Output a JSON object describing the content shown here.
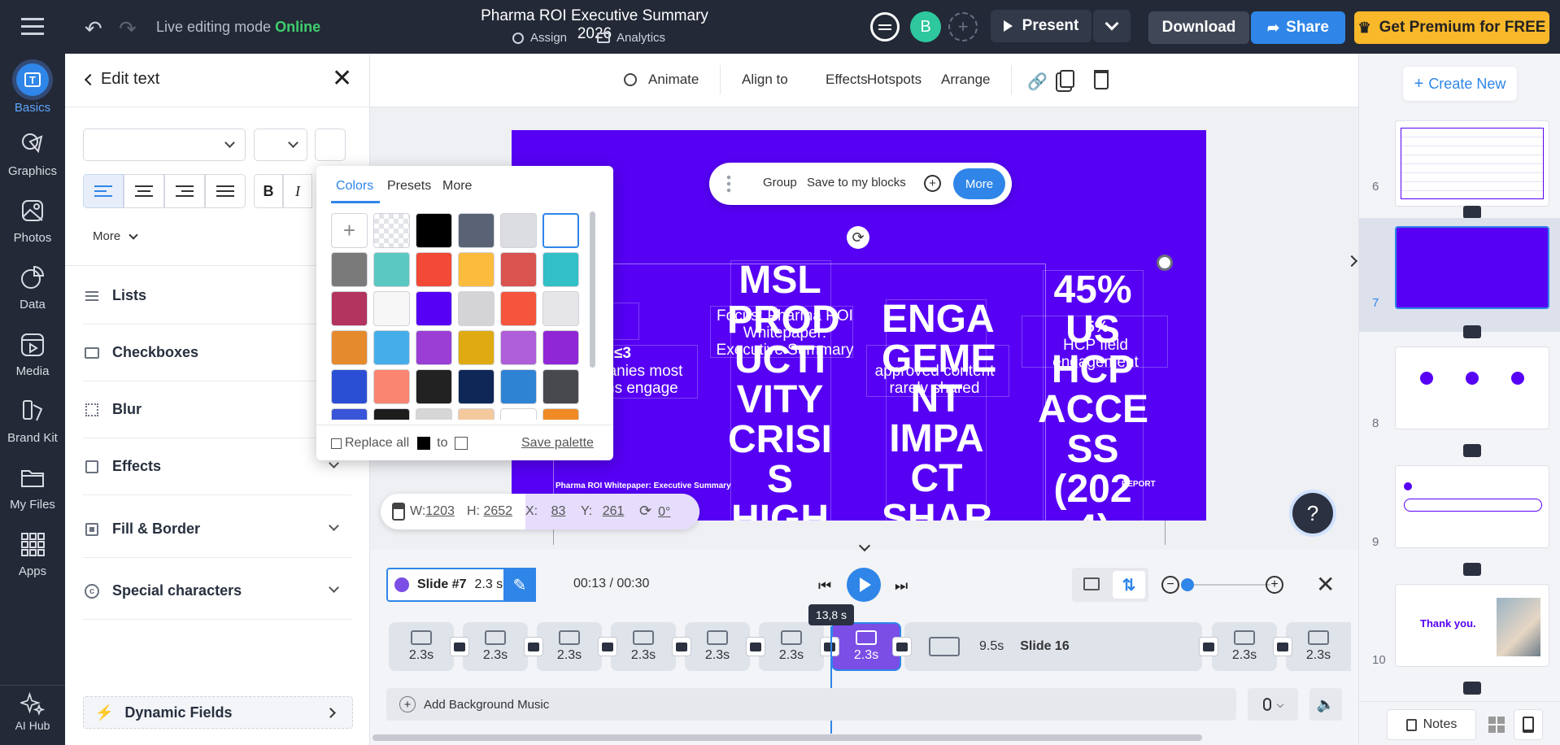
{
  "topbar": {
    "live_label": "Live editing mode",
    "live_status": "Online",
    "doc_title": "Pharma ROI Executive Summary 2026",
    "assign": "Assign",
    "analytics": "Analytics",
    "avatar_letter": "B",
    "present": "Present",
    "download": "Download",
    "share": "Share",
    "premium": "Get Premium for FREE"
  },
  "nav": [
    {
      "label": "Basics"
    },
    {
      "label": "Graphics"
    },
    {
      "label": "Photos"
    },
    {
      "label": "Data"
    },
    {
      "label": "Media"
    },
    {
      "label": "Brand Kit"
    },
    {
      "label": "My Files"
    },
    {
      "label": "Apps"
    },
    {
      "label": "AI Hub"
    }
  ],
  "panel": {
    "title": "Edit text",
    "more": "More",
    "sections": [
      "Lists",
      "Checkboxes",
      "Blur",
      "Effects",
      "Fill & Border",
      "Special characters"
    ],
    "dynamic_fields": "Dynamic Fields"
  },
  "colors_popup": {
    "tabs": [
      "Colors",
      "Presets",
      "More"
    ],
    "swatches": [
      [
        "add",
        "transparent",
        "#000000",
        "#5a6275",
        "#dcdde1",
        "#ffffff"
      ],
      [
        "#7a7a7a",
        "#5bc8c1",
        "#f24a36",
        "#fbbc3e",
        "#d9534f",
        "#32bfc6"
      ],
      [
        "#b2345f",
        "#f7f7f7",
        "#5600f4",
        "#d4d4d6",
        "#f4553c",
        "#e6e6e8"
      ],
      [
        "#e68a2e",
        "#45aee8",
        "#9a3ed6",
        "#e0ab12",
        "#ae5ed8",
        "#8f27d6"
      ],
      [
        "#2b4fd4",
        "#fa8570",
        "#222222",
        "#0f2756",
        "#2f83d3",
        "#48494d"
      ],
      [
        "#3955d8",
        "#1d1d1d",
        "#d6d6d6",
        "#f4c99e",
        "#ffffff",
        "#f08a24"
      ]
    ],
    "replace_all": "Replace all",
    "to": "to",
    "save_palette": "Save palette"
  },
  "toolbar": {
    "animate": "Animate",
    "align_to": "Align to",
    "effects": "Effects",
    "hotspots": "Hotspots",
    "arrange": "Arrange"
  },
  "floating_bar": {
    "group": "Group",
    "save_blocks": "Save to my blocks",
    "more": "More"
  },
  "dimensions": {
    "w_label": "W:",
    "w": "1203",
    "h_label": "H:",
    "h": "2652",
    "x_label": "X:",
    "x": "83",
    "y_label": "Y:",
    "y": "261",
    "rot": "0°"
  },
  "slide_text": {
    "col1_big": "MSL PROD UCTI VITY CRISI S HIGH",
    "col1_small": "Focus: Pharma ROI Whitepaper: Executive Summary",
    "col2_big": "ENGA GEME NT IMPA CT SHAR",
    "col2_small": "approved content rarely shared",
    "col3_big": "45% US HCP ACCE SS (202 4)",
    "col3_small": "HCP field engagement",
    "left_small_a": "≤3",
    "left_small_b": "panies most",
    "left_small_c": "ns engage",
    "footer_left": "Pharma ROI Whitepaper: Executive Summary",
    "footer_right": "REPORT",
    "col3_small_top": "5%"
  },
  "timeline": {
    "slide_label": "Slide #7",
    "slide_duration": "2.3 s",
    "time": "00:13 / 00:30",
    "marker": "13,8 s",
    "clips": [
      "2.3s",
      "2.3s",
      "2.3s",
      "2.3s",
      "2.3s",
      "2.3s",
      "2.3s"
    ],
    "long_clip_dur": "9.5s",
    "long_clip_name": "Slide 16",
    "end_clips": [
      "2.3s",
      "2.3s"
    ],
    "add_music": "Add Background Music"
  },
  "right": {
    "create_new": "Create New",
    "slides": [
      "6",
      "7",
      "8",
      "9",
      "10"
    ],
    "thanks": "Thank you.",
    "notes": "Notes"
  },
  "help": "?"
}
